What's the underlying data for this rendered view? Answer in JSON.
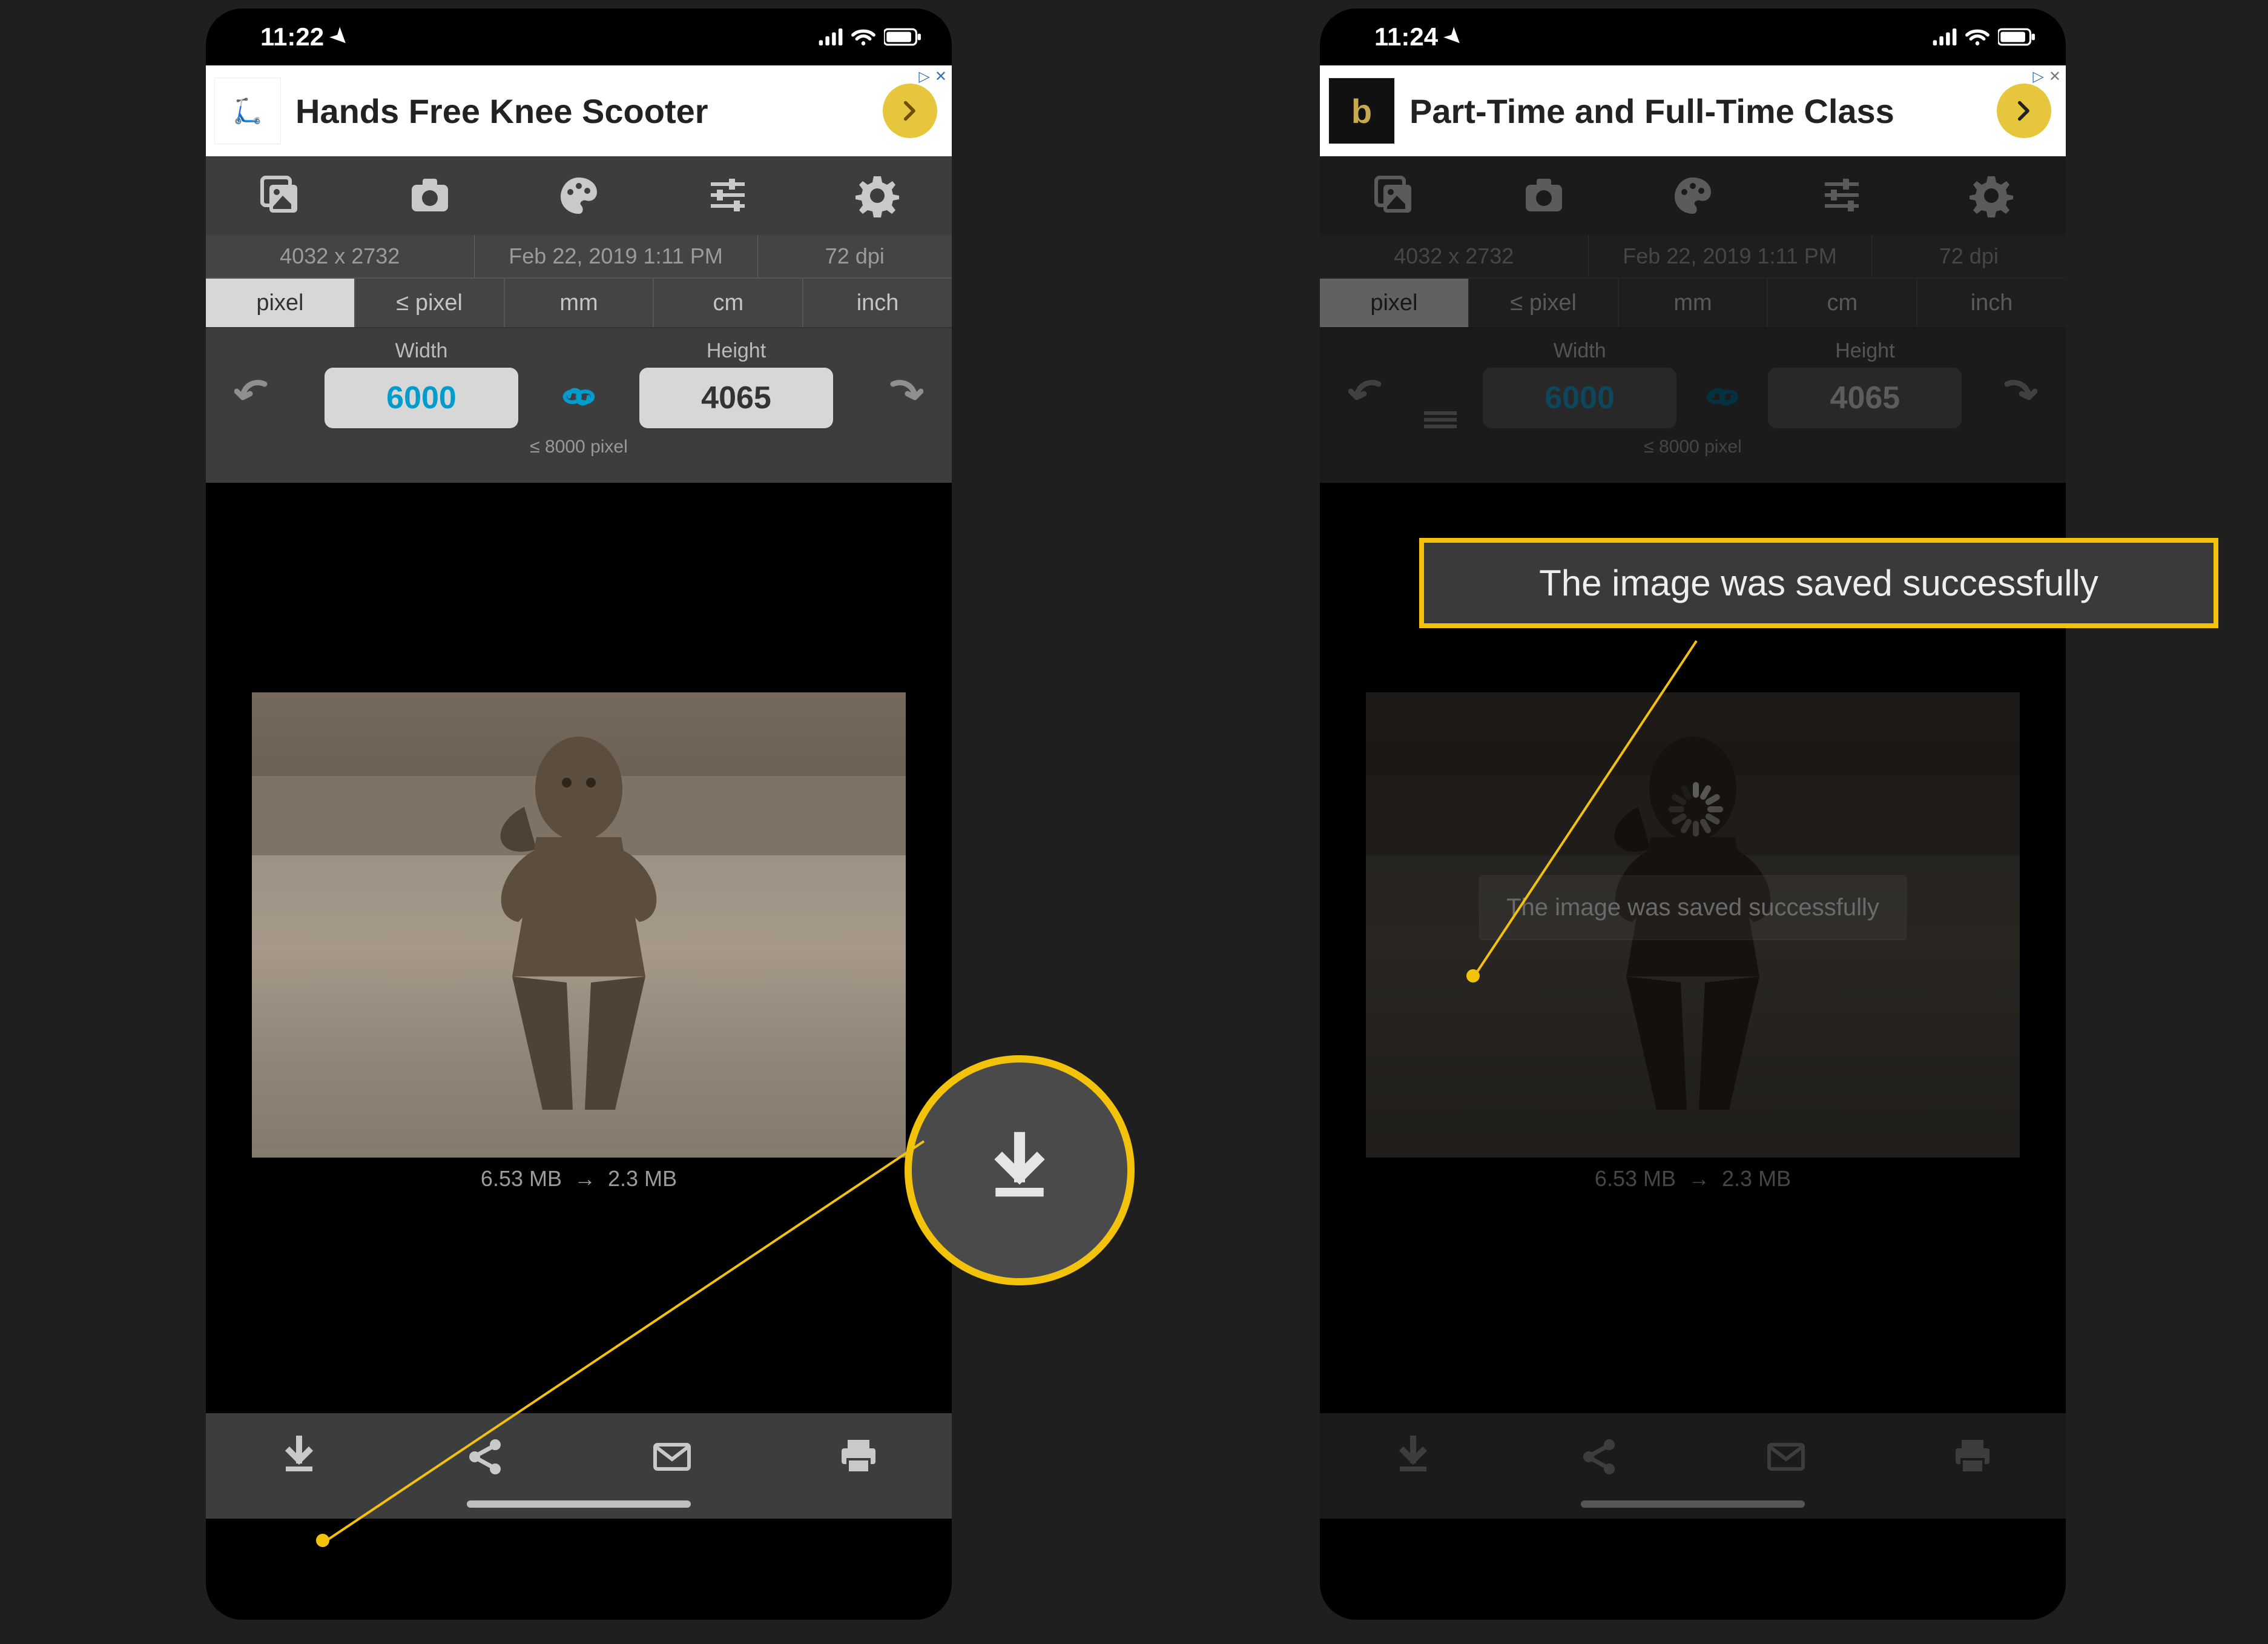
{
  "left": {
    "status": {
      "time": "11:22"
    },
    "ad": {
      "title": "Hands Free Knee Scooter"
    },
    "info": {
      "dimensions": "4032 x 2732",
      "date": "Feb 22, 2019 1:11 PM",
      "dpi": "72 dpi"
    },
    "units": [
      "pixel",
      "≤ pixel",
      "mm",
      "cm",
      "inch"
    ],
    "units_selected_index": 0,
    "size": {
      "width_label": "Width",
      "height_label": "Height",
      "width": "6000",
      "height": "4065",
      "hint": "≤ 8000 pixel"
    },
    "filesize": {
      "before": "6.53 MB",
      "after": "2.3 MB"
    }
  },
  "right": {
    "status": {
      "time": "11:24"
    },
    "ad": {
      "title": "Part-Time and Full-Time Class"
    },
    "info": {
      "dimensions": "4032 x 2732",
      "date": "Feb 22, 2019 1:11 PM",
      "dpi": "72 dpi"
    },
    "units": [
      "pixel",
      "≤ pixel",
      "mm",
      "cm",
      "inch"
    ],
    "units_selected_index": 0,
    "size": {
      "width_label": "Width",
      "height_label": "Height",
      "width": "6000",
      "height": "4065",
      "hint": "≤ 8000 pixel"
    },
    "filesize": {
      "before": "6.53 MB",
      "after": "2.3 MB"
    },
    "toast": "The image was saved successfully"
  },
  "callouts": {
    "save_rect_text": "The image was saved successfully"
  }
}
